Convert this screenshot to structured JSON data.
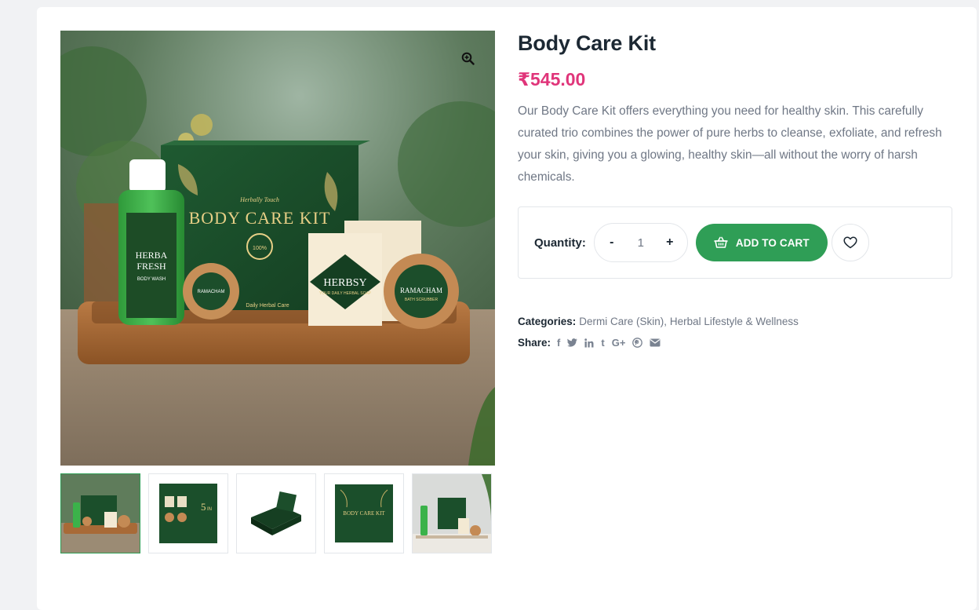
{
  "product": {
    "title": "Body Care Kit",
    "price": "₹545.00",
    "description": "Our Body Care Kit offers everything you need for healthy skin. This carefully curated trio combines the power of pure herbs to cleanse, exfoliate, and refresh your skin, giving you a glowing, healthy skin—all without the worry of harsh chemicals."
  },
  "gallery": {
    "zoom_icon": "zoom-in-icon",
    "main_image": {
      "box_text": "BODY CARE KIT",
      "box_brand": "Herbally Touch",
      "box_badge": "100% Herbal",
      "box_caption": "Daily Herbal Care",
      "bottle_brand": "Herbally Touch",
      "bottle_name_1": "HERBA",
      "bottle_name_2": "FRESH",
      "bottle_type": "BODY WASH",
      "soap_name": "HERBSY",
      "soap_sub": "YOUR DAILY HERBAL SOAP",
      "scrub_name": "RAMACHAM",
      "scrub_sub": "BATH SCRUBBER"
    },
    "thumbnails": [
      {
        "alt": "kit-on-tray",
        "active": true
      },
      {
        "alt": "kit-box-front",
        "active": false,
        "badge": "5 IN"
      },
      {
        "alt": "kit-box-angled",
        "active": false
      },
      {
        "alt": "kit-box-closed",
        "active": false,
        "label": "BODY CARE KIT"
      },
      {
        "alt": "kit-on-table",
        "active": false
      }
    ]
  },
  "cart": {
    "quantity_label": "Quantity:",
    "minus": "-",
    "plus": "+",
    "quantity_value": "1",
    "add_to_cart": "ADD TO CART",
    "add_icon": "basket-icon",
    "wishlist_icon": "heart-icon"
  },
  "meta": {
    "categories_label": "Categories:",
    "categories": [
      "Dermi Care (Skin)",
      "Herbal Lifestyle & Wellness"
    ],
    "separator": ",",
    "share_label": "Share:",
    "share_icons": [
      "facebook-icon",
      "twitter-icon",
      "linkedin-icon",
      "tumblr-icon",
      "google-plus-icon",
      "pinterest-icon",
      "email-icon"
    ],
    "share_glyphs": {
      "facebook": "f",
      "tumblr": "t",
      "google_plus": "G+"
    }
  },
  "colors": {
    "accent_green": "#2f9e56",
    "price_pink": "#e0357a",
    "text_dark": "#1c2833",
    "text_muted": "#6f7785"
  }
}
